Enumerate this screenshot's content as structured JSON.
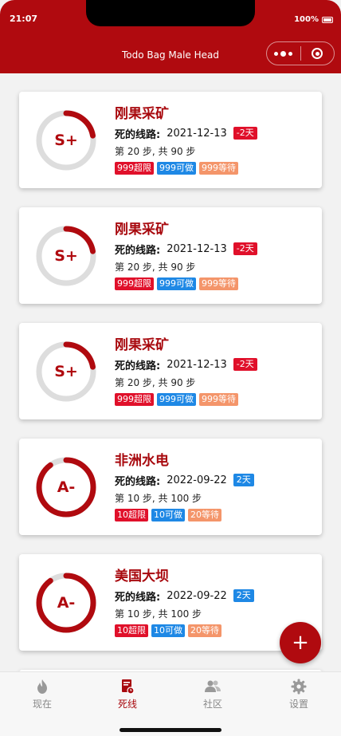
{
  "status": {
    "time": "21:07",
    "battery": "100%"
  },
  "nav": {
    "title": "Todo Bag Male Head"
  },
  "colors": {
    "brand": "#b00a0f",
    "over_limit": "#e0102a",
    "doable": "#1e88e5",
    "waiting": "#f4956a",
    "track": "#dddddd"
  },
  "cards": [
    {
      "grade": "S+",
      "title": "刚果采矿",
      "deadline_label": "死的线路:",
      "deadline_date": "2021-12-13",
      "days_badge": "-2天",
      "days_overdue": true,
      "steps": "第 20 步, 共 90 步",
      "progress": 0.222,
      "tags": {
        "over": "999超限",
        "doable": "999可做",
        "waiting": "999等待"
      }
    },
    {
      "grade": "S+",
      "title": "刚果采矿",
      "deadline_label": "死的线路:",
      "deadline_date": "2021-12-13",
      "days_badge": "-2天",
      "days_overdue": true,
      "steps": "第 20 步, 共 90 步",
      "progress": 0.222,
      "tags": {
        "over": "999超限",
        "doable": "999可做",
        "waiting": "999等待"
      }
    },
    {
      "grade": "S+",
      "title": "刚果采矿",
      "deadline_label": "死的线路:",
      "deadline_date": "2021-12-13",
      "days_badge": "-2天",
      "days_overdue": true,
      "steps": "第 20 步, 共 90 步",
      "progress": 0.222,
      "tags": {
        "over": "999超限",
        "doable": "999可做",
        "waiting": "999等待"
      }
    },
    {
      "grade": "A-",
      "title": "非洲水电",
      "deadline_label": "死的线路:",
      "deadline_date": "2022-09-22",
      "days_badge": "2天",
      "days_overdue": false,
      "steps": "第 10 步, 共 100 步",
      "progress": 0.9,
      "tags": {
        "over": "10超限",
        "doable": "10可做",
        "waiting": "20等待"
      }
    },
    {
      "grade": "A-",
      "title": "美国大坝",
      "deadline_label": "死的线路:",
      "deadline_date": "2022-09-22",
      "days_badge": "2天",
      "days_overdue": false,
      "steps": "第 10 步, 共 100 步",
      "progress": 0.9,
      "tags": {
        "over": "10超限",
        "doable": "10可做",
        "waiting": "20等待"
      }
    }
  ],
  "fab": {
    "label": "+"
  },
  "tabs": [
    {
      "label": "现在",
      "icon": "fire-icon",
      "active": false
    },
    {
      "label": "死线",
      "icon": "deadline-doc-icon",
      "active": true
    },
    {
      "label": "社区",
      "icon": "community-icon",
      "active": false
    },
    {
      "label": "设置",
      "icon": "gear-icon",
      "active": false
    }
  ]
}
